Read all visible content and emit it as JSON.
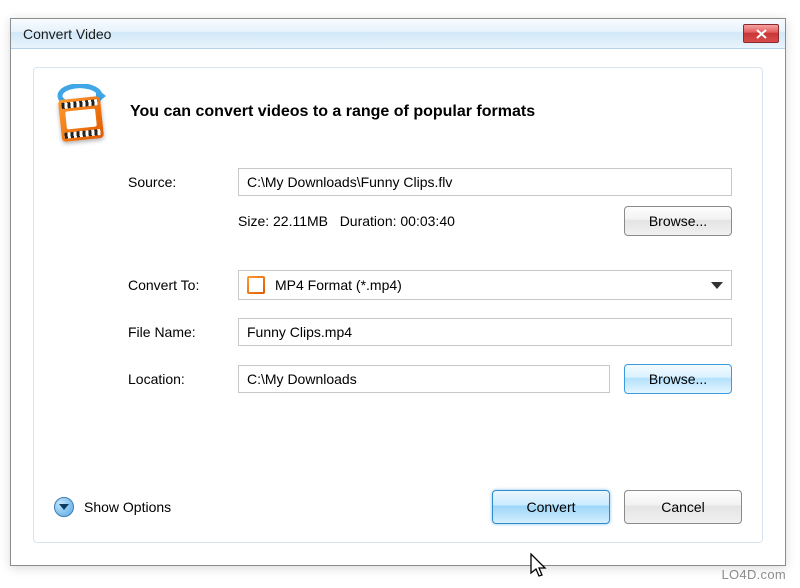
{
  "window": {
    "title": "Convert Video"
  },
  "header": {
    "headline": "You can convert videos to a range of popular formats"
  },
  "form": {
    "source_label": "Source:",
    "source_value": "C:\\My Downloads\\Funny Clips.flv",
    "size_label": "Size:",
    "size_value": "22.11MB",
    "duration_label": "Duration:",
    "duration_value": "00:03:40",
    "browse_source": "Browse...",
    "convert_to_label": "Convert To:",
    "convert_to_value": "MP4 Format (*.mp4)",
    "filename_label": "File Name:",
    "filename_value": "Funny Clips.mp4",
    "location_label": "Location:",
    "location_value": "C:\\My Downloads",
    "browse_location": "Browse..."
  },
  "footer": {
    "show_options": "Show Options",
    "convert": "Convert",
    "cancel": "Cancel"
  },
  "watermark": "LO4D.com"
}
